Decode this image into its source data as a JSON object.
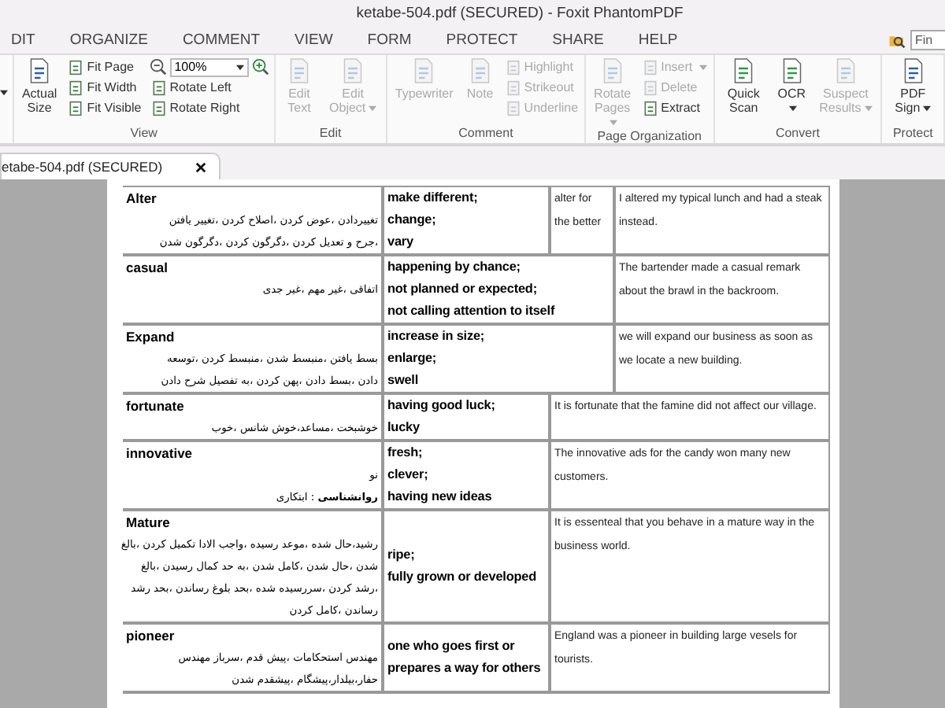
{
  "window": {
    "title": "ketabe-504.pdf (SECURED) - Foxit PhantomPDF"
  },
  "menu_tabs": [
    {
      "label": "DIT"
    },
    {
      "label": "ORGANIZE"
    },
    {
      "label": "COMMENT"
    },
    {
      "label": "VIEW"
    },
    {
      "label": "FORM"
    },
    {
      "label": "PROTECT"
    },
    {
      "label": "SHARE"
    },
    {
      "label": "HELP"
    }
  ],
  "find_field": {
    "placeholder": "Fin"
  },
  "ribbon_groups": [
    {
      "label": "View",
      "columns": [
        [
          {
            "kind": "large",
            "label": "Actual Size",
            "disabled": false,
            "menu": false
          }
        ],
        [
          {
            "kind": "small",
            "label": "Fit Page",
            "disabled": false,
            "menu": false
          },
          {
            "kind": "small",
            "label": "Fit Width",
            "disabled": false,
            "menu": false
          },
          {
            "kind": "small",
            "label": "Fit Visible",
            "disabled": false,
            "menu": false
          }
        ],
        [
          {
            "kind": "zoom",
            "label": "100%",
            "disabled": false,
            "menu": true
          },
          {
            "kind": "small",
            "label": "Rotate Left",
            "disabled": false,
            "menu": false
          },
          {
            "kind": "small",
            "label": "Rotate Right",
            "disabled": false,
            "menu": false
          }
        ]
      ]
    },
    {
      "label": "Edit",
      "columns": [
        [
          {
            "kind": "large",
            "label": "Edit Text",
            "disabled": true,
            "menu": false
          }
        ],
        [
          {
            "kind": "large",
            "label": "Edit Object",
            "disabled": true,
            "menu": true
          }
        ]
      ]
    },
    {
      "label": "Comment",
      "columns": [
        [
          {
            "kind": "large",
            "label": "Typewriter",
            "disabled": true,
            "menu": false
          }
        ],
        [
          {
            "kind": "large",
            "label": "Note",
            "disabled": true,
            "menu": false
          }
        ],
        [
          {
            "kind": "small",
            "label": "Highlight",
            "disabled": true,
            "menu": false
          },
          {
            "kind": "small",
            "label": "Strikeout",
            "disabled": true,
            "menu": false
          },
          {
            "kind": "small",
            "label": "Underline",
            "disabled": true,
            "menu": false
          }
        ]
      ]
    },
    {
      "label": "Page Organization",
      "columns": [
        [
          {
            "kind": "large",
            "label": "Rotate Pages",
            "disabled": true,
            "menu": true
          }
        ],
        [
          {
            "kind": "small",
            "label": "Insert",
            "disabled": true,
            "menu": true
          },
          {
            "kind": "small",
            "label": "Delete",
            "disabled": true,
            "menu": false
          },
          {
            "kind": "small",
            "label": "Extract",
            "disabled": false,
            "menu": false
          }
        ]
      ]
    },
    {
      "label": "Convert",
      "columns": [
        [
          {
            "kind": "large",
            "label": "Quick Scan",
            "disabled": false,
            "menu": false
          }
        ],
        [
          {
            "kind": "large",
            "label": "OCR",
            "disabled": false,
            "menu": true
          }
        ],
        [
          {
            "kind": "large",
            "label": "Suspect Results",
            "disabled": true,
            "menu": true
          }
        ]
      ]
    },
    {
      "label": "Protect",
      "columns": [
        [
          {
            "kind": "large",
            "label": "PDF Sign",
            "disabled": false,
            "menu": true
          }
        ]
      ]
    }
  ],
  "document_tab": {
    "label": "etabe-504.pdf (SECURED)"
  },
  "table_rows": [
    {
      "kind": "note",
      "word": "Alter",
      "persian": [
        "تغییردادن ،عوض کردن ،اصلاح کردن ،تغییر یافتن",
        "،جرح و تعدیل کردن ،دگرگون کردن ،دگرگون شدن"
      ],
      "definition": [
        "make different;",
        "change;",
        "vary"
      ],
      "note": "alter for the better",
      "example": "I altered my typical lunch and had a steak instead."
    },
    {
      "kind": "wide",
      "word": "casual",
      "persian": [
        "اتفاقی ،غیر مهم ،غیر جدی"
      ],
      "definition": [
        "happening by chance;",
        "not planned or expected;",
        "not calling attention to itself"
      ],
      "example": "The bartender made a casual remark about the brawl in the backroom."
    },
    {
      "kind": "wide",
      "word": "Expand",
      "persian": [
        "بسط یافتن ،منبسط شدن ،منبسط کردن ،توسعه",
        "دادن ،بسط دادن ،پهن کردن ،به تفصیل شرح دادن"
      ],
      "definition": [
        "increase in size;",
        "enlarge;",
        "swell"
      ],
      "example": "we will expand our business as soon as we locate a new building."
    },
    {
      "kind": "narrow",
      "word": "fortunate",
      "persian": [
        "خوشبخت ،مساعد،خوش شانس ،خوب"
      ],
      "definition": [
        "having good luck;",
        "lucky"
      ],
      "example": "It is fortunate that the famine did not affect our village."
    },
    {
      "kind": "narrow",
      "word": "innovative",
      "persian": [
        "نو",
        "**روانشناسی** : ابتکاری"
      ],
      "definition": [
        "fresh;",
        "clever;",
        "having new ideas"
      ],
      "example": "The innovative ads for the candy won many new customers."
    },
    {
      "kind": "narrow",
      "word": "Mature",
      "persian": [
        "رشید،حال شده ،موعد رسیده ،واجب الادا تکمیل کردن ،بالغ",
        "شدن ،حال شدن ،کامل شدن ،به حد کمال رسیدن ،بالغ",
        "،رشد کردن ،سررسیده شده ،بحد بلوغ رساندن ،بحد رشد",
        "رساندن ،کامل کردن"
      ],
      "definition": [
        "ripe;",
        "fully grown or developed"
      ],
      "example": "It is essenteal that you behave in a mature way in the business world."
    },
    {
      "kind": "narrow",
      "word": "pioneer",
      "persian": [
        "مهندس استحکامات ،پیش قدم ،سرباز مهندس",
        "حفار،بیلدار،پیشگام ،پیشقدم شدن"
      ],
      "definition": [
        "one who goes first or",
        "prepares a way for others"
      ],
      "example": "England was a pioneer in building large vesels for tourists."
    }
  ]
}
